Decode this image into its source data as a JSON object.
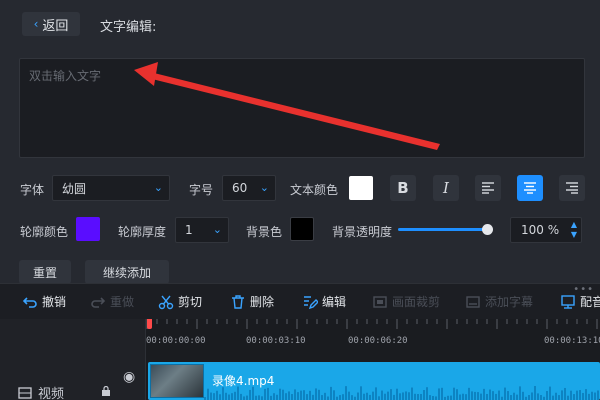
{
  "header": {
    "back_label": "返回",
    "title": "文字编辑:"
  },
  "editor": {
    "placeholder": "双击输入文字"
  },
  "font_row": {
    "font_label": "字体",
    "font_value": "幼圆",
    "size_label": "字号",
    "size_value": "60",
    "color_label": "文本颜色",
    "text_color": "#ffffff",
    "bold": "B",
    "italic": "I"
  },
  "outline_row": {
    "outline_color_label": "轮廓颜色",
    "outline_color": "#5a0dff",
    "thickness_label": "轮廓厚度",
    "thickness_value": "1",
    "bg_label": "背景色",
    "bg_color": "#000000",
    "opacity_label": "背景透明度",
    "opacity_value": "100 %",
    "opacity_fraction": 1.0
  },
  "actions": {
    "reset": "重置",
    "continue_add": "继续添加"
  },
  "toolbar": {
    "undo": "撤销",
    "redo": "重做",
    "cut": "剪切",
    "delete": "删除",
    "edit": "编辑",
    "disabled_1": "画面裁剪",
    "disabled_2": "添加字幕",
    "dub": "配音"
  },
  "timeline": {
    "ticks": [
      "00:00:00:00",
      "00:00:03:10",
      "00:00:06:20",
      "00:00:13:10"
    ],
    "track_label": "视频",
    "clip_name": "录像4.mp4"
  },
  "colors": {
    "accent": "#1e8fff",
    "clip": "#1aa7e8",
    "arrow": "#e8312e"
  }
}
